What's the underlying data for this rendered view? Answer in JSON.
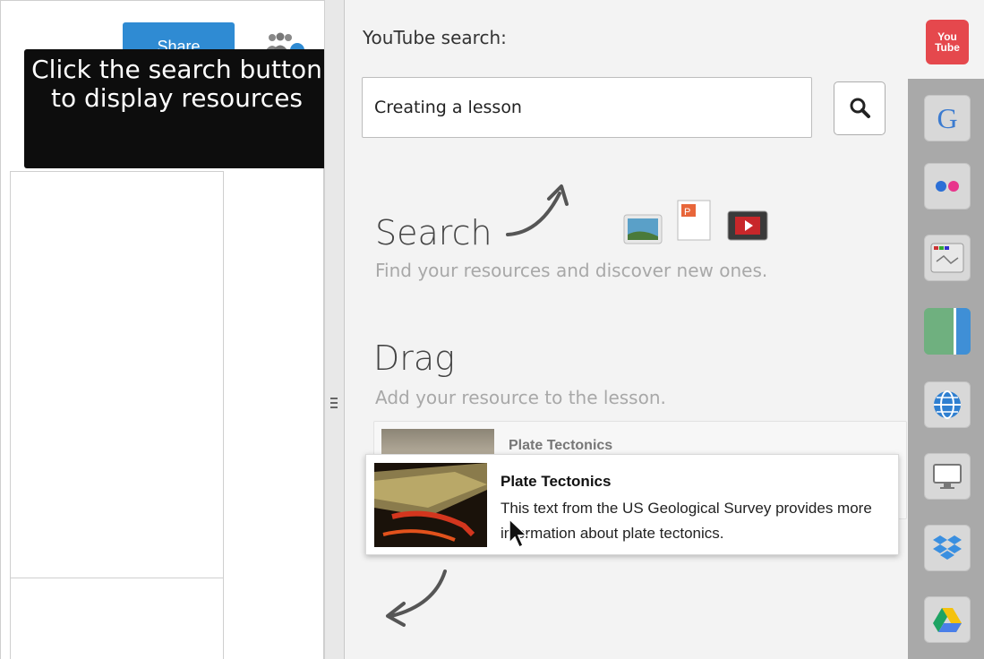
{
  "header": {
    "share_label": "Share"
  },
  "tooltip": {
    "text": "Click the search button to display resources"
  },
  "resource_panel": {
    "title": "YouTube search:",
    "search_value": "Creating a lesson",
    "steps": {
      "search_heading": "Search",
      "search_desc": "Find your resources and discover new ones.",
      "drag_heading": "Drag",
      "drag_desc": "Add your resource to the lesson."
    },
    "result_background": {
      "title": "Plate Tectonics"
    },
    "result_dragging": {
      "title": "Plate Tectonics",
      "description": "This text from the US Geological Survey provides more information about plate tectonics."
    }
  },
  "sources": [
    {
      "name": "youtube-icon",
      "label": "You\nTube"
    },
    {
      "name": "google-icon",
      "label": "G"
    },
    {
      "name": "flickr-icon"
    },
    {
      "name": "slideshow-icon"
    },
    {
      "name": "split-view-icon"
    },
    {
      "name": "globe-icon"
    },
    {
      "name": "monitor-icon"
    },
    {
      "name": "dropbox-icon"
    },
    {
      "name": "drive-icon"
    }
  ],
  "colors": {
    "share_button": "#2f8bd3",
    "tooltip_bg": "#0d0d0d",
    "panel_bg": "#f3f3f3",
    "youtube_red": "#e5484d",
    "iconbar_gray": "#a9a9a9"
  }
}
